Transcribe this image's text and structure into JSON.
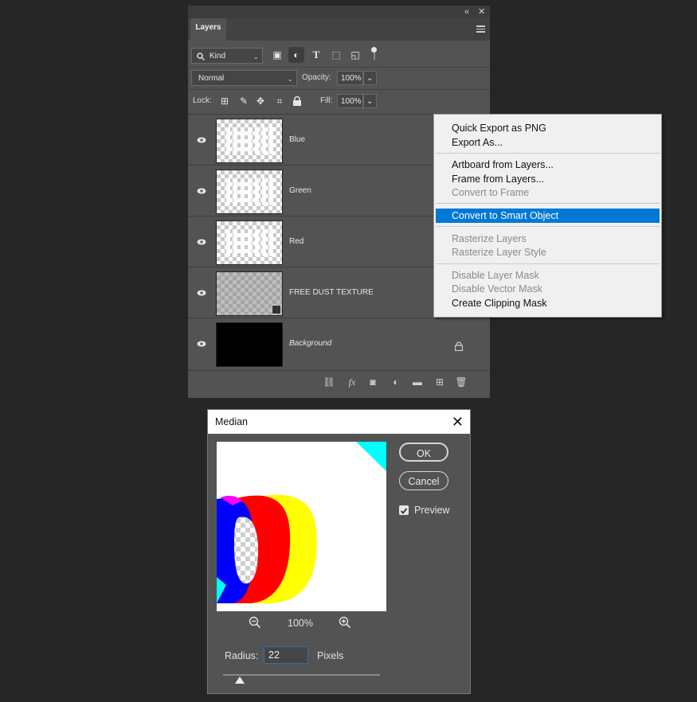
{
  "layers_panel": {
    "tab_label": "Layers",
    "collapse_icon": "double-chevron-left",
    "close_icon": "close",
    "filter": {
      "kind_label": "Kind"
    },
    "blend_mode": "Normal",
    "opacity_label": "Opacity:",
    "opacity_value": "100%",
    "lock_label": "Lock:",
    "fill_label": "Fill:",
    "fill_value": "100%",
    "layers": [
      {
        "name": "Blue"
      },
      {
        "name": "Green"
      },
      {
        "name": "Red"
      },
      {
        "name": "FREE DUST TEXTURE"
      },
      {
        "name": "Background"
      }
    ],
    "bottom_icons": [
      "link",
      "fx",
      "mask",
      "adjustment",
      "folder",
      "new-layer",
      "trash"
    ]
  },
  "context_menu": {
    "items": [
      {
        "label": "Quick Export as PNG",
        "state": "enabled"
      },
      {
        "label": "Export As...",
        "state": "enabled"
      },
      {
        "label": "Artboard from Layers...",
        "state": "enabled"
      },
      {
        "label": "Frame from Layers...",
        "state": "enabled"
      },
      {
        "label": "Convert to Frame",
        "state": "disabled"
      },
      {
        "label": "Convert to Smart Object",
        "state": "selected"
      },
      {
        "label": "Rasterize Layers",
        "state": "disabled"
      },
      {
        "label": "Rasterize Layer Style",
        "state": "disabled"
      },
      {
        "label": "Disable Layer Mask",
        "state": "disabled"
      },
      {
        "label": "Disable Vector Mask",
        "state": "disabled"
      },
      {
        "label": "Create Clipping Mask",
        "state": "enabled"
      }
    ]
  },
  "median_dialog": {
    "title": "Median",
    "ok_label": "OK",
    "cancel_label": "Cancel",
    "preview_label": "Preview",
    "preview_checked": true,
    "zoom": "100%",
    "radius_label": "Radius:",
    "radius_value": "22",
    "radius_unit": "Pixels",
    "colors": {
      "cyan": "#00ffff",
      "magenta": "#ff00ff",
      "blue": "#0000ff",
      "red": "#ff0000",
      "yellow": "#ffff00"
    }
  }
}
